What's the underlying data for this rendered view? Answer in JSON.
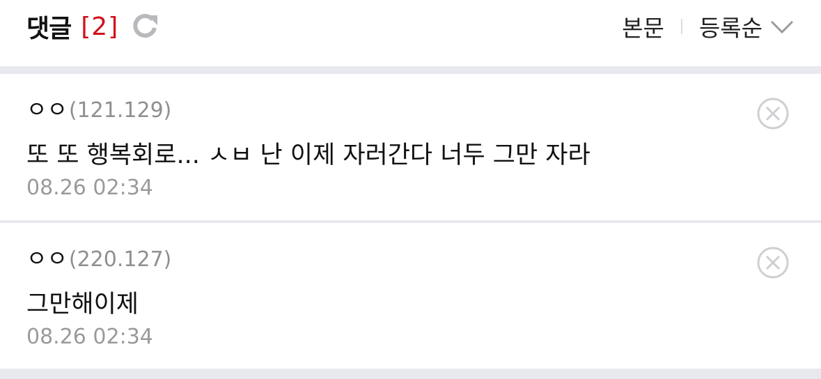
{
  "header": {
    "title": "댓글",
    "count": "[2]",
    "view_link": "본문",
    "sort_label": "등록순"
  },
  "comments": [
    {
      "nickname": "ㅇㅇ",
      "ip": "(121.129)",
      "text": "또 또 행복회로... ㅅㅂ 난 이제 자러간다 너두 그만 자라",
      "time": "08.26 02:34"
    },
    {
      "nickname": "ㅇㅇ",
      "ip": "(220.127)",
      "text": "그만해이제",
      "time": "08.26 02:34"
    }
  ],
  "icons": {
    "refresh": "refresh-icon",
    "sort_chevron": "chevron-down-icon",
    "delete": "close-circle-icon"
  },
  "colors": {
    "accent": "#d0101a",
    "muted": "#9a9a9a",
    "band": "#e8e9ee"
  }
}
